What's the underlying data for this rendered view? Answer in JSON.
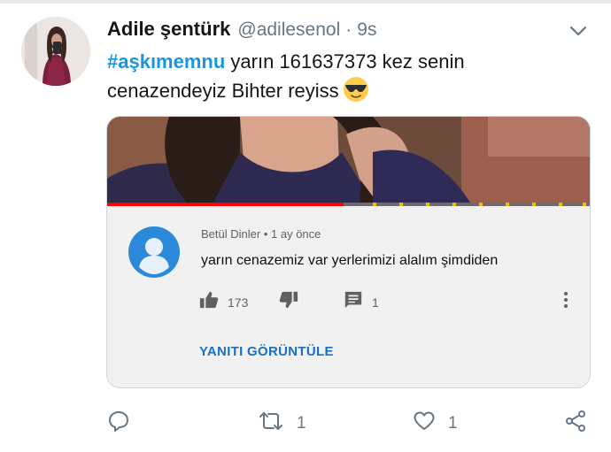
{
  "tweet": {
    "display_name": "Adile şentürk",
    "handle": "@adilesenol",
    "separator": "·",
    "time": "9s",
    "hashtag": "#aşkımemnu",
    "text_after_hashtag": " yarın 161637373 kez senin cenazendeyiz Bihter reyiss",
    "emoji": "sunglasses-emoji"
  },
  "embedded_comment": {
    "progress_fraction": 0.49,
    "author": "Betül Dinler",
    "meta_separator": "•",
    "age": "1 ay önce",
    "text": "yarın cenazemiz var yerlerimizi alalım şimdiden",
    "likes": "173",
    "replies": "1",
    "view_replies_label": "YANITI GÖRÜNTÜLE"
  },
  "actions": {
    "retweets": "1",
    "likes": "1"
  },
  "colors": {
    "hashtag": "#1b95e0",
    "secondary_text": "#657786",
    "youtube_red": "#ff0000",
    "reply_link": "#1a6fbf"
  }
}
